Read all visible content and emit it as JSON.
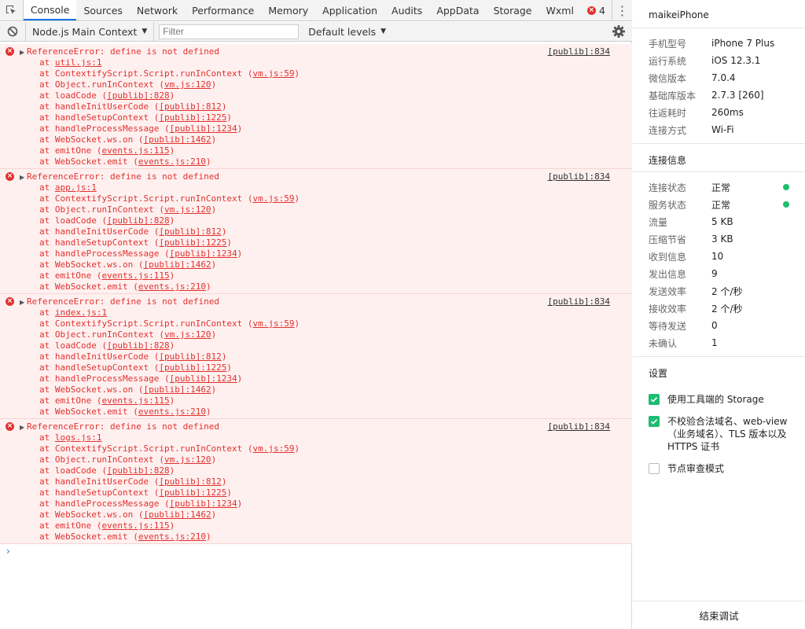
{
  "tabs": [
    "Console",
    "Sources",
    "Network",
    "Performance",
    "Memory",
    "Application",
    "Audits",
    "AppData",
    "Storage",
    "Wxml"
  ],
  "error_count": "4",
  "toolbar": {
    "context": "Node.js Main Context",
    "filter_placeholder": "Filter",
    "levels": "Default levels"
  },
  "messages": [
    {
      "text": "ReferenceError: define is not defined",
      "source": "[publib]:834",
      "frames": [
        {
          "fn": "at ",
          "loc": "util.js:1",
          "paren": false
        },
        {
          "fn": "at ContextifyScript.Script.runInContext ",
          "loc": "vm.js:59",
          "paren": true
        },
        {
          "fn": "at Object.runInContext ",
          "loc": "vm.js:120",
          "paren": true
        },
        {
          "fn": "at loadCode ",
          "loc": "[publib]:828",
          "paren": true
        },
        {
          "fn": "at handleInitUserCode ",
          "loc": "[publib]:812",
          "paren": true
        },
        {
          "fn": "at handleSetupContext ",
          "loc": "[publib]:1225",
          "paren": true
        },
        {
          "fn": "at handleProcessMessage ",
          "loc": "[publib]:1234",
          "paren": true
        },
        {
          "fn": "at WebSocket.ws.on ",
          "loc": "[publib]:1462",
          "paren": true
        },
        {
          "fn": "at emitOne ",
          "loc": "events.js:115",
          "paren": true
        },
        {
          "fn": "at WebSocket.emit ",
          "loc": "events.js:210",
          "paren": true
        }
      ]
    },
    {
      "text": "ReferenceError: define is not defined",
      "source": "[publib]:834",
      "frames": [
        {
          "fn": "at ",
          "loc": "app.js:1",
          "paren": false
        },
        {
          "fn": "at ContextifyScript.Script.runInContext ",
          "loc": "vm.js:59",
          "paren": true
        },
        {
          "fn": "at Object.runInContext ",
          "loc": "vm.js:120",
          "paren": true
        },
        {
          "fn": "at loadCode ",
          "loc": "[publib]:828",
          "paren": true
        },
        {
          "fn": "at handleInitUserCode ",
          "loc": "[publib]:812",
          "paren": true
        },
        {
          "fn": "at handleSetupContext ",
          "loc": "[publib]:1225",
          "paren": true
        },
        {
          "fn": "at handleProcessMessage ",
          "loc": "[publib]:1234",
          "paren": true
        },
        {
          "fn": "at WebSocket.ws.on ",
          "loc": "[publib]:1462",
          "paren": true
        },
        {
          "fn": "at emitOne ",
          "loc": "events.js:115",
          "paren": true
        },
        {
          "fn": "at WebSocket.emit ",
          "loc": "events.js:210",
          "paren": true
        }
      ]
    },
    {
      "text": "ReferenceError: define is not defined",
      "source": "[publib]:834",
      "frames": [
        {
          "fn": "at ",
          "loc": "index.js:1",
          "paren": false
        },
        {
          "fn": "at ContextifyScript.Script.runInContext ",
          "loc": "vm.js:59",
          "paren": true
        },
        {
          "fn": "at Object.runInContext ",
          "loc": "vm.js:120",
          "paren": true
        },
        {
          "fn": "at loadCode ",
          "loc": "[publib]:828",
          "paren": true
        },
        {
          "fn": "at handleInitUserCode ",
          "loc": "[publib]:812",
          "paren": true
        },
        {
          "fn": "at handleSetupContext ",
          "loc": "[publib]:1225",
          "paren": true
        },
        {
          "fn": "at handleProcessMessage ",
          "loc": "[publib]:1234",
          "paren": true
        },
        {
          "fn": "at WebSocket.ws.on ",
          "loc": "[publib]:1462",
          "paren": true
        },
        {
          "fn": "at emitOne ",
          "loc": "events.js:115",
          "paren": true
        },
        {
          "fn": "at WebSocket.emit ",
          "loc": "events.js:210",
          "paren": true
        }
      ]
    },
    {
      "text": "ReferenceError: define is not defined",
      "source": "[publib]:834",
      "frames": [
        {
          "fn": "at ",
          "loc": "logs.js:1",
          "paren": false
        },
        {
          "fn": "at ContextifyScript.Script.runInContext ",
          "loc": "vm.js:59",
          "paren": true
        },
        {
          "fn": "at Object.runInContext ",
          "loc": "vm.js:120",
          "paren": true
        },
        {
          "fn": "at loadCode ",
          "loc": "[publib]:828",
          "paren": true
        },
        {
          "fn": "at handleInitUserCode ",
          "loc": "[publib]:812",
          "paren": true
        },
        {
          "fn": "at handleSetupContext ",
          "loc": "[publib]:1225",
          "paren": true
        },
        {
          "fn": "at handleProcessMessage ",
          "loc": "[publib]:1234",
          "paren": true
        },
        {
          "fn": "at WebSocket.ws.on ",
          "loc": "[publib]:1462",
          "paren": true
        },
        {
          "fn": "at emitOne ",
          "loc": "events.js:115",
          "paren": true
        },
        {
          "fn": "at WebSocket.emit ",
          "loc": "events.js:210",
          "paren": true
        }
      ]
    }
  ],
  "right_panel": {
    "device_name": "maikeiPhone",
    "device_info": [
      {
        "k": "手机型号",
        "v": "iPhone 7 Plus"
      },
      {
        "k": "运行系统",
        "v": "iOS 12.3.1"
      },
      {
        "k": "微信版本",
        "v": "7.0.4"
      },
      {
        "k": "基础库版本",
        "v": "2.7.3 [260]"
      },
      {
        "k": "往返耗时",
        "v": "260ms"
      },
      {
        "k": "连接方式",
        "v": "Wi-Fi"
      }
    ],
    "conn_title": "连接信息",
    "conn_info": [
      {
        "k": "连接状态",
        "v": "正常",
        "dot": true
      },
      {
        "k": "服务状态",
        "v": "正常",
        "dot": true
      },
      {
        "k": "流量",
        "v": "5 KB"
      },
      {
        "k": "压缩节省",
        "v": "3 KB"
      },
      {
        "k": "收到信息",
        "v": "10"
      },
      {
        "k": "发出信息",
        "v": "9"
      },
      {
        "k": "发送效率",
        "v": "2 个/秒"
      },
      {
        "k": "接收效率",
        "v": "2 个/秒"
      },
      {
        "k": "等待发送",
        "v": "0"
      },
      {
        "k": "未确认",
        "v": "1"
      }
    ],
    "settings_title": "设置",
    "settings": [
      {
        "label": "使用工具端的 Storage",
        "checked": true
      },
      {
        "label": "不校验合法域名、web-view（业务域名）、TLS 版本以及 HTTPS 证书",
        "checked": true
      },
      {
        "label": "节点审查模式",
        "checked": false
      }
    ],
    "end_button": "结束调试"
  },
  "colors": {
    "error": "#e0322e",
    "error_bg": "#fff0f0",
    "accent": "#1a73e8",
    "ok": "#1dbd72"
  }
}
